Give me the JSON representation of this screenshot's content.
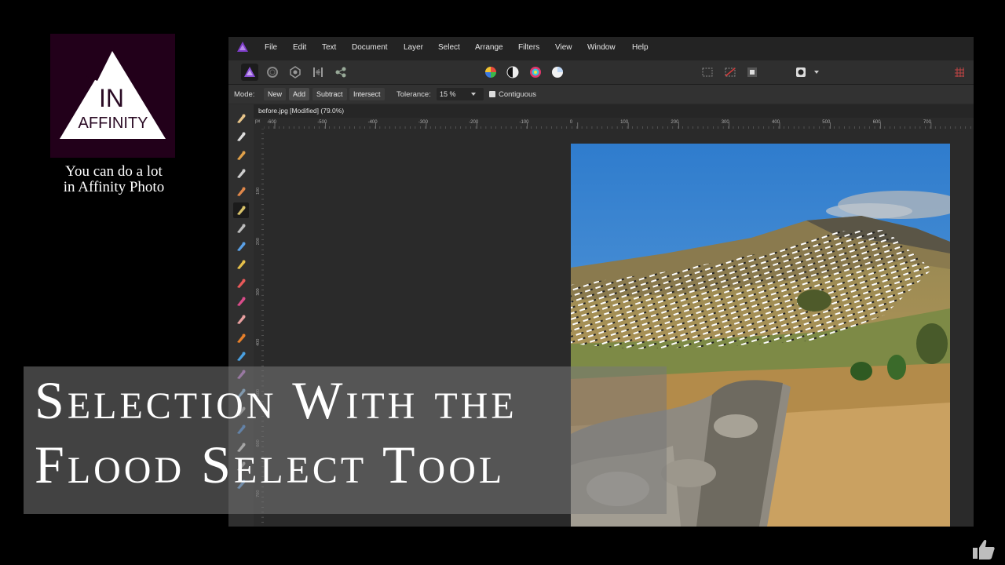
{
  "brand": {
    "logo_text_top": "IN",
    "logo_text_bottom": "AFFINITY",
    "tagline_line1": "You can do a lot",
    "tagline_line2": "in Affinity Photo"
  },
  "menu": [
    "File",
    "Edit",
    "Text",
    "Document",
    "Layer",
    "Select",
    "Arrange",
    "Filters",
    "View",
    "Window",
    "Help"
  ],
  "toolbar": {
    "persona_icons": [
      "photo-persona-icon",
      "liquify-persona-icon",
      "develop-persona-icon",
      "tone-mapping-persona-icon",
      "export-persona-icon"
    ],
    "adjustment_icons": [
      "color-wheel-icon",
      "contrast-icon",
      "color-balance-icon",
      "white-balance-icon"
    ],
    "selection_icons": [
      "marquee-icon",
      "no-selection-icon",
      "invert-selection-icon"
    ],
    "mask_icon": "quick-mask-icon",
    "grid_icon": "grid-icon"
  },
  "context": {
    "mode_label": "Mode:",
    "modes": [
      "New",
      "Add",
      "Subtract",
      "Intersect"
    ],
    "active_mode": "Add",
    "tolerance_label": "Tolerance:",
    "tolerance_value": "15 %",
    "contiguous_label": "Contiguous",
    "contiguous_checked": true
  },
  "document": {
    "title": "before.jpg [Modified] (79.0%)",
    "ruler_unit": "px",
    "ruler_h_labels": [
      "-600",
      "-500",
      "-400",
      "-300",
      "-200",
      "-100",
      "0",
      "100",
      "200",
      "300",
      "400",
      "500",
      "600",
      "700"
    ],
    "ruler_v_labels": [
      "100",
      "200",
      "300",
      "400",
      "500",
      "600",
      "700"
    ]
  },
  "tools": [
    "hand-tool-icon",
    "move-tool-icon",
    "color-picker-tool-icon",
    "crop-tool-icon",
    "selection-brush-tool-icon",
    "flood-select-tool-icon",
    "marquee-tool-icon",
    "fill-tool-icon",
    "gradient-tool-icon",
    "paint-brush-tool-icon",
    "color-replacement-tool-icon",
    "erase-tool-icon",
    "dodge-tool-icon",
    "clone-tool-icon",
    "healing-tool-icon",
    "blur-tool-icon",
    "smudge-tool-icon",
    "shape-tool-icon",
    "text-tool-icon",
    "table-tool-icon",
    "zoom-tool-icon"
  ],
  "active_tool": "flood-select-tool-icon",
  "title": {
    "line1": "Selection With the",
    "line2": "Flood Select Tool"
  },
  "colors": {
    "accent_purple": "#7d3cc8",
    "logo_bg": "#22001a",
    "sky": "#3d86d2",
    "grass": "#c49b55"
  },
  "like_icon": "thumbs-up-icon"
}
